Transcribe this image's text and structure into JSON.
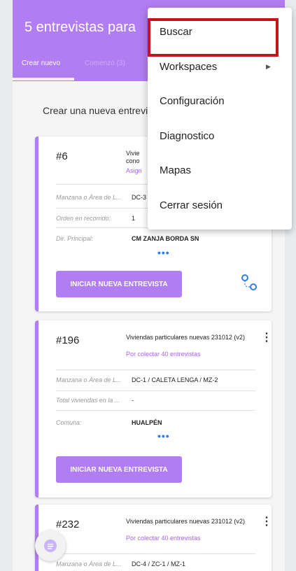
{
  "header": {
    "title": "5 entrevistas para",
    "tabs": [
      {
        "label": "Crear nuevo"
      },
      {
        "label": "Comenzó (3)"
      }
    ]
  },
  "subtitle": "Crear una nueva entrevis",
  "cards": [
    {
      "id": "#6",
      "survey_title": "Vivie cono",
      "status": "Asign",
      "fields": [
        {
          "label": "Manzana o Área de L...",
          "value": "DC-3"
        },
        {
          "label": "Orden en recorrido:",
          "value": "1"
        },
        {
          "label": "Dir. Principal:",
          "value": "CM ZANJA BORDA SN"
        }
      ],
      "action_label": "INICIAR NUEVA ENTREVISTA"
    },
    {
      "id": "#196",
      "survey_title": "Viviendas particulares nuevas 231012 (v2)",
      "status": "Por colectar 40 entrevistas",
      "fields": [
        {
          "label": "Manzana o Área de L...",
          "value": "DC-1 / CALETA LENGA / MZ-2"
        },
        {
          "label": "Total viviendas en la ...",
          "value": "-"
        },
        {
          "label": "Comuna:",
          "value": "HUALPÉN"
        }
      ],
      "action_label": "INICIAR NUEVA ENTREVISTA"
    },
    {
      "id": "#232",
      "survey_title": "Viviendas particulares nuevas 231012 (v2)",
      "status": "Por colectar 40 entrevistas",
      "fields": [
        {
          "label": "Manzana o Área de L...",
          "value": "DC-4 / ZC-1 / MZ-1"
        }
      ]
    }
  ],
  "more_indicator": "•••",
  "menu": {
    "items": [
      "Buscar",
      "Workspaces",
      "Configuración",
      "Diagnostico",
      "Mapas",
      "Cerrar sesión"
    ],
    "submenu_arrow": "▶"
  },
  "colors": {
    "accent": "#b17df2",
    "status": "#a464ee",
    "highlight": "#c4151c",
    "dots": "#2f7fe8"
  },
  "icons": {
    "kebab": "kebab-menu-icon",
    "map_pin": "map-pin-route-icon",
    "fab": "fab-icon"
  }
}
